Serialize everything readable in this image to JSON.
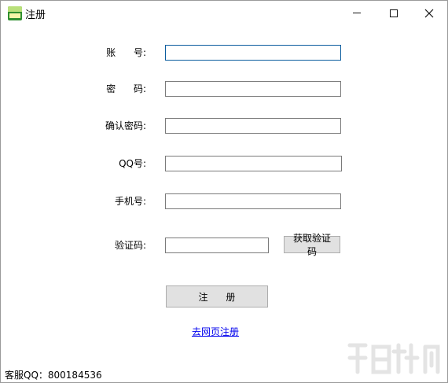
{
  "window": {
    "title": "注册",
    "controls": {
      "minimize": "minimize",
      "maximize": "maximize",
      "close": "close"
    }
  },
  "form": {
    "account_label": "账      号:",
    "password_label": "密      码:",
    "confirm_password_label": "确认密码:",
    "qq_label": "QQ号:",
    "phone_label": "手机号:",
    "verify_code_label": "验证码:",
    "account_value": "",
    "password_value": "",
    "confirm_password_value": "",
    "qq_value": "",
    "phone_value": "",
    "verify_code_value": "",
    "get_code_button": "获取验证码",
    "register_button": "注      册",
    "web_register_link": "去网页注册"
  },
  "footer": {
    "support_text": "客服QQ：800184536"
  },
  "colors": {
    "focus_border": "#0a5c9e",
    "link": "#0000ee",
    "button_bg": "#e1e1e1"
  },
  "icons": {
    "app": "app-logo-icon",
    "minimize": "minimize-icon",
    "maximize": "maximize-icon",
    "close": "close-icon"
  }
}
